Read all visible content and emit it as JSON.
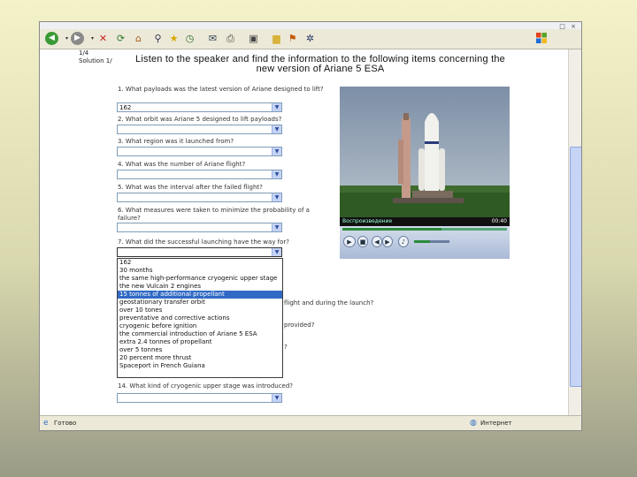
{
  "window": {
    "controls": "_ □ ×",
    "status_left": "Готово",
    "status_right": "Интернет"
  },
  "toolbar": {
    "icons": [
      "back-icon",
      "forward-icon",
      "stop-icon",
      "refresh-icon",
      "home-icon",
      "search-icon",
      "favorites-icon",
      "history-icon",
      "mail-icon",
      "print-icon",
      "edit-icon",
      "folder-icon",
      "messenger-icon",
      "bluetooth-icon"
    ],
    "colors": {
      "back": "#3a9a35",
      "forward": "#8a8a8a"
    }
  },
  "page": {
    "corner_text": [
      "1/4",
      "Solution 1/"
    ],
    "heading_line1": "Listen to the speaker and find the information to the following items concerning the",
    "heading_line2": "new version of Ariane 5 ESA",
    "questions": [
      {
        "text": "1. What payloads was the latest version of Ariane designed to lift?",
        "answer": "162"
      },
      {
        "text": "2. What orbit was Ariane 5 designed to lift payloads?",
        "answer": ""
      },
      {
        "text": "3. What region was it launched from?",
        "answer": ""
      },
      {
        "text": "4. What was the number of Ariane flight?",
        "answer": ""
      },
      {
        "text": "5. What was the interval after the failed flight?",
        "answer": ""
      },
      {
        "text": "6. What measures were taken to minimize the probability of a failure?",
        "answer": ""
      },
      {
        "text": "7. What did the successful launching have the way for?",
        "answer": ""
      },
      {
        "text": "14. What kind of cryogenic upper stage was introduced?",
        "answer": ""
      }
    ],
    "dropdown_options": [
      "162",
      "30 months",
      "the same high-performance cryogenic upper stage",
      "the new Vulcain 2 engines",
      "15 tonnes of additional propellant",
      "geostationary transfer orbit",
      "over 10 tones",
      "preventative and corrective actions",
      "cryogenic before ignition",
      "the commercial introduction of Ariane 5 ESA",
      "extra 2.4 tonnes of propellant",
      "over 5 tonnes",
      "20 percent more thrust",
      "Spaceport in French Guiana"
    ],
    "selected_option_index": 4,
    "hidden_fragments": [
      {
        "text": "flight and during the launch?"
      },
      {
        "text": "provided?"
      },
      {
        "text": "?"
      }
    ]
  },
  "player": {
    "status": "Воспроизведение",
    "time": "00:40",
    "seek_fraction": 0.6,
    "volume_fraction": 0.45
  }
}
